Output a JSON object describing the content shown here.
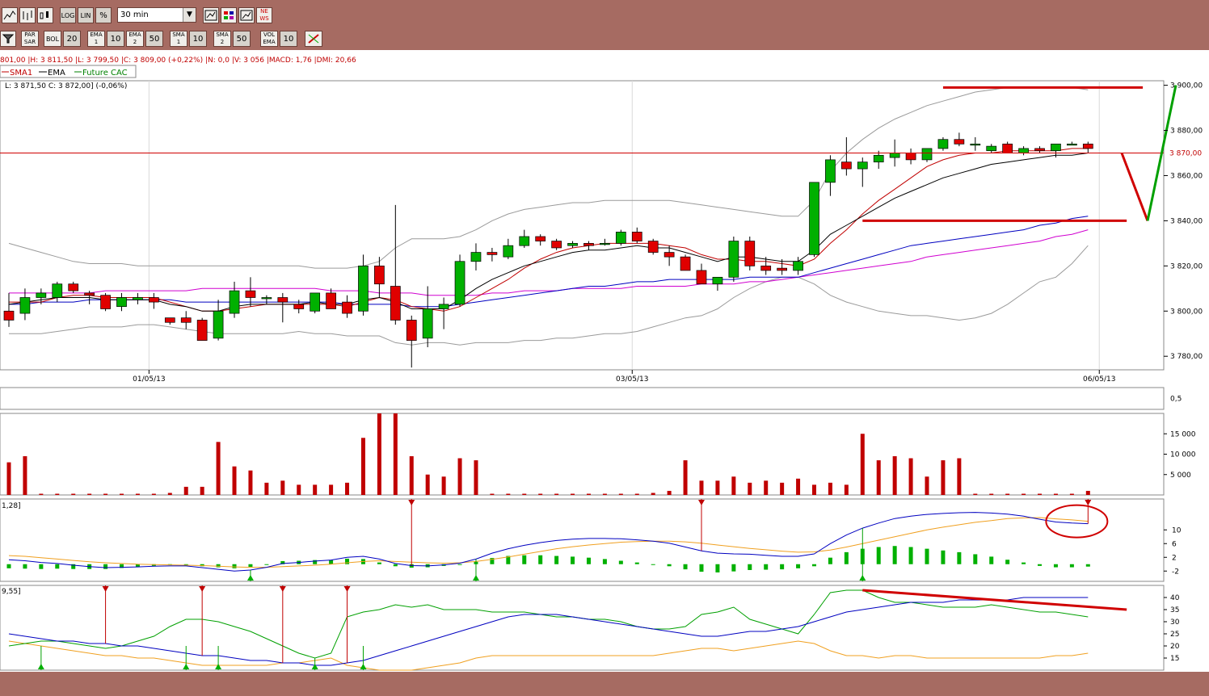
{
  "toolbar": {
    "interval": "30 min",
    "log_label": "LOG",
    "lin_label": "LIN",
    "pct_label": "%",
    "news_label": "NEWS",
    "indicators": [
      {
        "name": "PAR SAR",
        "value": ""
      },
      {
        "name": "BOL",
        "value": "20"
      },
      {
        "name": "EMA 1",
        "value": "10"
      },
      {
        "name": "EMA 2",
        "value": "50"
      },
      {
        "name": "SMA 1",
        "value": "10"
      },
      {
        "name": "SMA 2",
        "value": "50"
      },
      {
        "name": "VOL EMA",
        "value": "10"
      }
    ]
  },
  "info_line": "801,00 |H: 3 811,50 |L: 3 799,50 |C: 3 809,00 (+0,22%) |N: 0,0 |V: 3 056 |MACD: 1,76 |DMI: 20,66",
  "legend": {
    "sma": "SMA1",
    "ema": "EMA",
    "future": "Future CAC"
  },
  "ohlc_line": "L: 3 871,50   C: 3 872,00] (-0,06%)",
  "price_label": "3 870,00",
  "macd_label": "1,28]",
  "dmi_label": "9,55]",
  "x_labels": [
    {
      "label": "01/05/13",
      "index": 9
    },
    {
      "label": "03/05/13",
      "index": 39
    },
    {
      "label": "06/05/13",
      "index": 68
    }
  ],
  "chart_data": {
    "type": "candlestick",
    "symbol": "Future CAC",
    "interval": "30 min",
    "price_ylim": [
      3774,
      3902
    ],
    "price_ticks": [
      3780,
      3800,
      3820,
      3840,
      3860,
      3880,
      3900
    ],
    "price_tick_labels": [
      "3 780,00",
      "3 800,00",
      "3 820,00",
      "3 840,00",
      "3 860,00",
      "3 880,00",
      "3 900,00"
    ],
    "candles": [
      [
        3800,
        3808,
        3793,
        3796
      ],
      [
        3799,
        3810,
        3796,
        3806
      ],
      [
        3806,
        3810,
        3803,
        3808
      ],
      [
        3806,
        3813,
        3804,
        3812
      ],
      [
        3812,
        3813,
        3808,
        3809
      ],
      [
        3808,
        3809,
        3803,
        3807
      ],
      [
        3807,
        3808,
        3800,
        3801
      ],
      [
        3802,
        3808,
        3800,
        3806
      ],
      [
        3805,
        3808,
        3803,
        3806
      ],
      [
        3806,
        3808,
        3801,
        3804
      ],
      [
        3797,
        3797,
        3794,
        3795
      ],
      [
        3797,
        3800,
        3792,
        3795
      ],
      [
        3796,
        3797,
        3787,
        3787
      ],
      [
        3788,
        3805,
        3787,
        3800
      ],
      [
        3799,
        3813,
        3797,
        3809
      ],
      [
        3809,
        3815,
        3802,
        3806
      ],
      [
        3806,
        3807,
        3803,
        3806
      ],
      [
        3806,
        3808,
        3795,
        3804
      ],
      [
        3803,
        3805,
        3799,
        3801
      ],
      [
        3800,
        3806,
        3799,
        3808
      ],
      [
        3808,
        3810,
        3801,
        3801
      ],
      [
        3804,
        3807,
        3797,
        3799
      ],
      [
        3800,
        3825,
        3798,
        3820
      ],
      [
        3820,
        3824,
        3806,
        3812
      ],
      [
        3811,
        3847,
        3794,
        3796
      ],
      [
        3796,
        3798,
        3775,
        3787
      ],
      [
        3788,
        3811,
        3784,
        3801
      ],
      [
        3801,
        3806,
        3792,
        3803
      ],
      [
        3803,
        3825,
        3802,
        3822
      ],
      [
        3822,
        3830,
        3818,
        3826
      ],
      [
        3826,
        3828,
        3822,
        3825
      ],
      [
        3824,
        3832,
        3823,
        3829
      ],
      [
        3829,
        3836,
        3828,
        3833
      ],
      [
        3833,
        3834,
        3829,
        3831
      ],
      [
        3831,
        3832,
        3827,
        3828
      ],
      [
        3829,
        3831,
        3828,
        3830
      ],
      [
        3830,
        3831,
        3827,
        3829
      ],
      [
        3830,
        3832,
        3829,
        3830
      ],
      [
        3830,
        3836,
        3829,
        3835
      ],
      [
        3835,
        3837,
        3830,
        3831
      ],
      [
        3831,
        3832,
        3825,
        3826
      ],
      [
        3826,
        3829,
        3820,
        3824
      ],
      [
        3824,
        3825,
        3818,
        3818
      ],
      [
        3818,
        3821,
        3812,
        3812
      ],
      [
        3812,
        3815,
        3809,
        3815
      ],
      [
        3815,
        3833,
        3813,
        3831
      ],
      [
        3831,
        3833,
        3818,
        3820
      ],
      [
        3820,
        3824,
        3816,
        3818
      ],
      [
        3819,
        3823,
        3816,
        3818
      ],
      [
        3818,
        3824,
        3816,
        3822
      ],
      [
        3825,
        3857,
        3824,
        3857
      ],
      [
        3857,
        3869,
        3851,
        3867
      ],
      [
        3866,
        3877,
        3860,
        3863
      ],
      [
        3863,
        3868,
        3855,
        3866
      ],
      [
        3866,
        3871,
        3863,
        3869
      ],
      [
        3868,
        3876,
        3864,
        3870
      ],
      [
        3870,
        3872,
        3865,
        3867
      ],
      [
        3867,
        3872,
        3866,
        3872
      ],
      [
        3872,
        3877,
        3871,
        3876
      ],
      [
        3876,
        3879,
        3873,
        3874
      ],
      [
        3874,
        3877,
        3871,
        3874
      ],
      [
        3871,
        3874,
        3870,
        3873
      ],
      [
        3874,
        3875,
        3870,
        3870
      ],
      [
        3870,
        3873,
        3869,
        3872
      ],
      [
        3872,
        3873,
        3870,
        3871
      ],
      [
        3871,
        3873,
        3868,
        3874
      ],
      [
        3874,
        3875,
        3874,
        3874
      ],
      [
        3874,
        3875,
        3870,
        3872
      ]
    ],
    "ema_overlay": [
      3803,
      3804,
      3805,
      3806,
      3806,
      3806,
      3805,
      3805,
      3805,
      3805,
      3803,
      3802,
      3800,
      3800,
      3802,
      3803,
      3803,
      3803,
      3803,
      3804,
      3803,
      3803,
      3805,
      3806,
      3804,
      3801,
      3801,
      3801,
      3805,
      3810,
      3814,
      3817,
      3820,
      3822,
      3824,
      3826,
      3827,
      3827,
      3828,
      3829,
      3828,
      3828,
      3826,
      3824,
      3822,
      3824,
      3824,
      3823,
      3822,
      3822,
      3827,
      3834,
      3838,
      3842,
      3846,
      3850,
      3853,
      3856,
      3859,
      3861,
      3863,
      3865,
      3866,
      3867,
      3868,
      3869,
      3869,
      3870
    ],
    "sma_overlay": [
      3804,
      3804,
      3804,
      3806,
      3807,
      3807,
      3806,
      3806,
      3806,
      3806,
      3804,
      3802,
      3800,
      3800,
      3801,
      3802,
      3803,
      3803,
      3803,
      3803,
      3803,
      3802,
      3804,
      3806,
      3805,
      3802,
      3801,
      3800,
      3802,
      3806,
      3810,
      3814,
      3819,
      3823,
      3826,
      3828,
      3829,
      3830,
      3830,
      3830,
      3830,
      3829,
      3828,
      3825,
      3823,
      3823,
      3822,
      3822,
      3821,
      3820,
      3823,
      3830,
      3836,
      3843,
      3849,
      3854,
      3859,
      3864,
      3867,
      3869,
      3870,
      3870,
      3871,
      3871,
      3871,
      3871,
      3872,
      3872
    ],
    "ema50_overlay": [
      3803,
      3803,
      3804,
      3804,
      3804,
      3805,
      3805,
      3805,
      3805,
      3805,
      3805,
      3804,
      3804,
      3804,
      3804,
      3804,
      3804,
      3804,
      3804,
      3804,
      3804,
      3803,
      3803,
      3803,
      3803,
      3802,
      3802,
      3802,
      3803,
      3804,
      3805,
      3806,
      3807,
      3808,
      3809,
      3810,
      3811,
      3811,
      3812,
      3813,
      3813,
      3814,
      3814,
      3814,
      3814,
      3814,
      3815,
      3815,
      3815,
      3815,
      3817,
      3819,
      3821,
      3823,
      3825,
      3827,
      3829,
      3830,
      3831,
      3832,
      3833,
      3834,
      3835,
      3836,
      3838,
      3839,
      3841,
      3842
    ],
    "sma50_overlay": [
      3808,
      3808,
      3808,
      3808,
      3808,
      3808,
      3809,
      3809,
      3809,
      3809,
      3809,
      3809,
      3810,
      3810,
      3810,
      3810,
      3810,
      3810,
      3810,
      3810,
      3809,
      3809,
      3809,
      3808,
      3808,
      3808,
      3807,
      3807,
      3807,
      3807,
      3808,
      3808,
      3809,
      3809,
      3809,
      3810,
      3810,
      3810,
      3810,
      3811,
      3811,
      3811,
      3811,
      3812,
      3812,
      3812,
      3813,
      3813,
      3814,
      3815,
      3816,
      3817,
      3818,
      3819,
      3820,
      3821,
      3822,
      3824,
      3825,
      3826,
      3827,
      3828,
      3829,
      3830,
      3831,
      3833,
      3834,
      3836
    ],
    "boll_upper": [
      3830,
      3828,
      3826,
      3824,
      3822,
      3821,
      3821,
      3821,
      3820,
      3820,
      3820,
      3820,
      3820,
      3820,
      3820,
      3820,
      3820,
      3820,
      3820,
      3819,
      3819,
      3819,
      3820,
      3822,
      3828,
      3832,
      3832,
      3832,
      3833,
      3836,
      3840,
      3843,
      3845,
      3846,
      3847,
      3848,
      3848,
      3849,
      3849,
      3849,
      3849,
      3849,
      3848,
      3847,
      3846,
      3845,
      3844,
      3843,
      3842,
      3842,
      3849,
      3862,
      3870,
      3876,
      3881,
      3885,
      3888,
      3891,
      3893,
      3895,
      3897,
      3898,
      3899,
      3899,
      3899,
      3899,
      3899,
      3898
    ],
    "boll_lower": [
      3790,
      3790,
      3790,
      3791,
      3792,
      3793,
      3793,
      3793,
      3794,
      3794,
      3793,
      3792,
      3791,
      3790,
      3790,
      3790,
      3790,
      3790,
      3791,
      3790,
      3790,
      3789,
      3789,
      3789,
      3786,
      3785,
      3786,
      3786,
      3785,
      3786,
      3786,
      3786,
      3787,
      3787,
      3788,
      3788,
      3789,
      3790,
      3790,
      3791,
      3793,
      3795,
      3797,
      3798,
      3801,
      3806,
      3810,
      3813,
      3815,
      3815,
      3812,
      3807,
      3804,
      3802,
      3800,
      3799,
      3798,
      3798,
      3797,
      3796,
      3797,
      3799,
      3803,
      3808,
      3813,
      3815,
      3821,
      3829
    ],
    "hlines": [
      {
        "price": 3899,
        "from_index": 58,
        "to_index": 70,
        "color": "#d00000"
      },
      {
        "price": 3840,
        "from_index": 53,
        "to_index": 69,
        "color": "#d00000"
      },
      {
        "price": 3870,
        "from_index": 0,
        "to_index": 70,
        "color": "#d00000"
      }
    ],
    "projection": {
      "points": [
        [
          3870,
          3840
        ],
        [
          3840,
          3900
        ]
      ],
      "colors": [
        "#d00000",
        "#00a000"
      ]
    },
    "volume": {
      "ylim": [
        0,
        20000
      ],
      "ticks": [
        5000,
        10000,
        15000
      ],
      "tick_labels": [
        "5 000",
        "10 000",
        "15 000"
      ],
      "values": [
        8000,
        9500,
        0,
        0,
        0,
        0,
        0,
        0,
        0,
        0,
        500,
        2000,
        2000,
        13000,
        7000,
        6000,
        3000,
        3500,
        2500,
        2500,
        2500,
        3000,
        14000,
        20000,
        20000,
        9500,
        5000,
        4500,
        9000,
        8500,
        0,
        0,
        0,
        0,
        0,
        0,
        0,
        0,
        0,
        0,
        500,
        1000,
        8500,
        3500,
        3500,
        4500,
        3000,
        3500,
        3000,
        4000,
        2500,
        3000,
        2500,
        15000,
        8500,
        9500,
        9000,
        4500,
        8500,
        9000,
        0,
        0,
        0,
        0,
        0,
        0,
        0,
        1000
      ]
    },
    "upper_panel": {
      "ylim": [
        0,
        1
      ],
      "tick_labels": [
        "0,5"
      ]
    },
    "macd": {
      "ylim": [
        -5,
        19
      ],
      "ticks": [
        -2,
        2,
        6,
        10
      ],
      "tick_labels": [
        "-2",
        "2",
        "6",
        "10"
      ],
      "macd_line": [
        1.3,
        1.0,
        0.5,
        0.2,
        -0.3,
        -0.7,
        -1.0,
        -0.9,
        -0.8,
        -0.6,
        -0.5,
        -0.5,
        -1.0,
        -1.5,
        -2.0,
        -1.7,
        -0.9,
        0.2,
        0.5,
        0.9,
        1.2,
        2.0,
        2.3,
        1.5,
        0.2,
        -0.4,
        -0.5,
        -0.2,
        0.3,
        1.5,
        3.2,
        4.5,
        5.5,
        6.3,
        6.9,
        7.3,
        7.5,
        7.5,
        7.4,
        7.1,
        6.7,
        6.1,
        5.0,
        3.9,
        3.2,
        3.0,
        2.9,
        2.6,
        2.3,
        2.3,
        3.0,
        6.0,
        8.5,
        10.5,
        12.0,
        13.3,
        14.0,
        14.5,
        14.8,
        15.0,
        15.1,
        14.9,
        14.6,
        14.0,
        13.1,
        12.3,
        12.0,
        11.8
      ],
      "signal_line": [
        2.5,
        2.3,
        1.9,
        1.5,
        1.1,
        0.7,
        0.4,
        0.2,
        0.0,
        -0.1,
        -0.2,
        -0.3,
        -0.4,
        -0.6,
        -0.8,
        -0.9,
        -0.9,
        -0.7,
        -0.5,
        -0.3,
        0.0,
        0.4,
        0.8,
        1.0,
        0.8,
        0.6,
        0.4,
        0.3,
        0.4,
        0.8,
        1.4,
        2.1,
        2.9,
        3.7,
        4.5,
        5.1,
        5.6,
        6.0,
        6.4,
        6.6,
        6.7,
        6.7,
        6.5,
        6.1,
        5.6,
        5.1,
        4.6,
        4.2,
        3.8,
        3.5,
        3.6,
        4.1,
        5.0,
        6.0,
        7.0,
        8.0,
        9.0,
        10.0,
        10.8,
        11.5,
        12.2,
        12.7,
        13.3,
        13.5,
        13.6,
        13.2,
        12.9,
        12.5
      ],
      "histogram": [
        -1.2,
        -1.3,
        -1.4,
        -1.3,
        -1.4,
        -1.4,
        -1.4,
        -1.1,
        -0.8,
        -0.5,
        -0.3,
        -0.2,
        -0.6,
        -0.9,
        -1.2,
        -0.8,
        0.0,
        0.9,
        1.0,
        1.2,
        1.2,
        1.6,
        1.5,
        0.5,
        -0.6,
        -1.0,
        -0.9,
        -0.5,
        -0.1,
        0.7,
        1.8,
        2.4,
        2.6,
        2.6,
        2.4,
        2.2,
        1.9,
        1.5,
        1.0,
        0.5,
        0.0,
        -0.6,
        -1.5,
        -2.2,
        -2.4,
        -2.1,
        -1.7,
        -1.6,
        -1.5,
        -1.2,
        -0.6,
        1.9,
        3.5,
        4.5,
        5.0,
        5.3,
        5.0,
        4.5,
        4.0,
        3.5,
        2.9,
        2.2,
        1.3,
        0.5,
        -0.5,
        -0.9,
        -0.9,
        -0.7
      ],
      "sell_signals": [
        25,
        43,
        67
      ],
      "buy_signals": [
        15,
        29,
        53
      ]
    },
    "dmi": {
      "ylim": [
        10,
        45
      ],
      "ticks": [
        15,
        20,
        25,
        30,
        35,
        40
      ],
      "tick_labels": [
        "15",
        "20",
        "25",
        "30",
        "35",
        "40"
      ],
      "adx": [
        25,
        24,
        23,
        22,
        22,
        21,
        21,
        20,
        20,
        19,
        18,
        17,
        16,
        16,
        15,
        14,
        14,
        13,
        13,
        12,
        12,
        13,
        14,
        16,
        18,
        20,
        22,
        24,
        26,
        28,
        30,
        32,
        33,
        33,
        33,
        32,
        31,
        30,
        29,
        28,
        27,
        26,
        25,
        24,
        24,
        25,
        26,
        26,
        27,
        28,
        30,
        32,
        34,
        35,
        36,
        37,
        38,
        38,
        38,
        39,
        39,
        39,
        39,
        40,
        40,
        40,
        40,
        40
      ],
      "di_plus": [
        20,
        21,
        22,
        22,
        21,
        20,
        19,
        20,
        22,
        24,
        28,
        31,
        31,
        30,
        28,
        26,
        23,
        20,
        17,
        15,
        17,
        32,
        34,
        35,
        37,
        36,
        37,
        35,
        35,
        35,
        34,
        34,
        34,
        33,
        32,
        32,
        31,
        31,
        30,
        28,
        27,
        27,
        28,
        33,
        34,
        36,
        31,
        29,
        27,
        25,
        33,
        42,
        43,
        43,
        40,
        38,
        38,
        37,
        36,
        36,
        36,
        37,
        36,
        35,
        34,
        34,
        33,
        32
      ],
      "di_minus": [
        22,
        21,
        20,
        19,
        18,
        17,
        16,
        16,
        15,
        15,
        14,
        13,
        12,
        12,
        12,
        12,
        12,
        13,
        13,
        14,
        15,
        12,
        11,
        10,
        10,
        10,
        11,
        12,
        13,
        15,
        16,
        16,
        16,
        16,
        16,
        16,
        16,
        16,
        16,
        16,
        16,
        17,
        18,
        19,
        19,
        18,
        19,
        20,
        21,
        22,
        21,
        18,
        16,
        16,
        15,
        16,
        16,
        15,
        15,
        15,
        15,
        15,
        15,
        15,
        15,
        16,
        16,
        17
      ],
      "trendline": [
        [
          53,
          43
        ],
        [
          69,
          35
        ]
      ],
      "sell_signals": [
        6,
        12,
        17,
        21
      ],
      "buy_signals": [
        2,
        11,
        13,
        19,
        22
      ]
    }
  }
}
